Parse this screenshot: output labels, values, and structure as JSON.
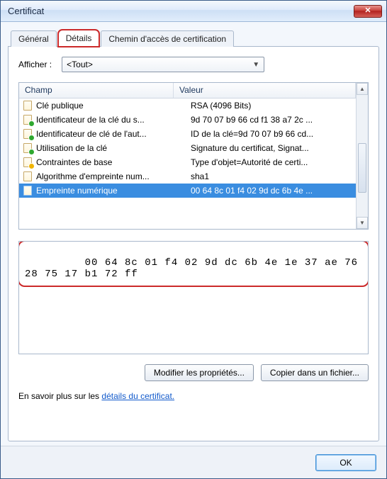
{
  "window": {
    "title": "Certificat",
    "close_label": "✕"
  },
  "tabs": {
    "general": "Général",
    "details": "Détails",
    "path": "Chemin d'accès de certification",
    "active": "details"
  },
  "filter": {
    "label": "Afficher :",
    "selected": "<Tout>"
  },
  "columns": {
    "field": "Champ",
    "value": "Valeur"
  },
  "rows": [
    {
      "icon": "plain",
      "field": "Clé publique",
      "value": "RSA (4096 Bits)"
    },
    {
      "icon": "green",
      "field": "Identificateur de la clé du s...",
      "value": "9d 70 07 b9 66 cd f1 38 a7 2c ..."
    },
    {
      "icon": "green",
      "field": "Identificateur de clé de l'aut...",
      "value": "ID de la clé=9d 70 07 b9 66 cd..."
    },
    {
      "icon": "green",
      "field": "Utilisation de la clé",
      "value": "Signature du certificat, Signat..."
    },
    {
      "icon": "yellow",
      "field": "Contraintes de base",
      "value": "Type d'objet=Autorité de certi..."
    },
    {
      "icon": "plain",
      "field": "Algorithme d'empreinte num...",
      "value": "sha1"
    },
    {
      "icon": "plain",
      "field": "Empreinte numérique",
      "value": "00 64 8c 01 f4 02 9d dc 6b 4e ...",
      "selected": true
    }
  ],
  "detail_text": " 00 64 8c 01 f4 02 9d dc 6b 4e 1e 37 ae 76 28 75 17 b1 72 ff",
  "buttons": {
    "edit_props": "Modifier les propriétés...",
    "copy_file": "Copier dans un fichier..."
  },
  "link": {
    "prefix": "En savoir plus sur les ",
    "text": "détails du certificat."
  },
  "footer": {
    "ok": "OK"
  }
}
